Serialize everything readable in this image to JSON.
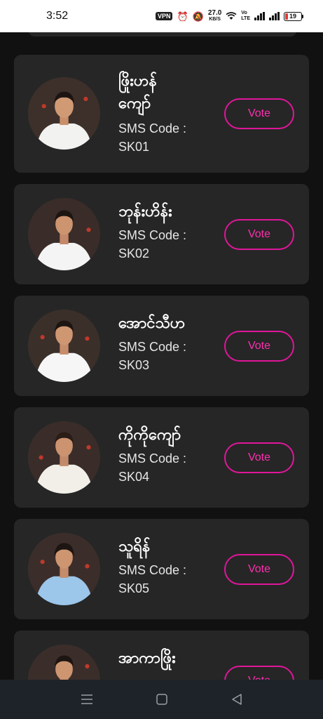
{
  "status_bar": {
    "time": "3:52",
    "vpn": "VPN",
    "net_speed_value": "27.0",
    "net_speed_unit": "KB/S",
    "volte_top": "Vo",
    "volte_bottom": "LTE",
    "battery_level": "19",
    "battery_color": "#e53935"
  },
  "contestants": [
    {
      "name_line1": "ဖြိုးဟန်",
      "name_line2": "ကျော်",
      "sms_label": "SMS Code :",
      "sms_code": "SK01",
      "vote_label": "Vote",
      "shirt": "#f2f2f0"
    },
    {
      "name_line1": "ဘုန်းဟိန်း",
      "name_line2": "",
      "sms_label": "SMS Code :",
      "sms_code": "SK02",
      "vote_label": "Vote",
      "shirt": "#f4f4f4"
    },
    {
      "name_line1": "အောင်သီဟ",
      "name_line2": "",
      "sms_label": "SMS Code :",
      "sms_code": "SK03",
      "vote_label": "Vote",
      "shirt": "#f6f6f6"
    },
    {
      "name_line1": "ကိုကိုကျော်",
      "name_line2": "",
      "sms_label": "SMS Code :",
      "sms_code": "SK04",
      "vote_label": "Vote",
      "shirt": "#f1efe8"
    },
    {
      "name_line1": "သူရိန်",
      "name_line2": "",
      "sms_label": "SMS Code :",
      "sms_code": "SK05",
      "vote_label": "Vote",
      "shirt": "#9cc6ea"
    },
    {
      "name_line1": "အာကာဖြိုး",
      "name_line2": "",
      "sms_label": "",
      "sms_code": "",
      "vote_label": "Vote",
      "shirt": "#e8c56a"
    }
  ],
  "colors": {
    "accent": "#e0169a",
    "card_background": "#262626",
    "page_background": "#111111"
  },
  "nav": {
    "icons": [
      "recent-apps-icon",
      "home-icon",
      "back-icon"
    ]
  }
}
